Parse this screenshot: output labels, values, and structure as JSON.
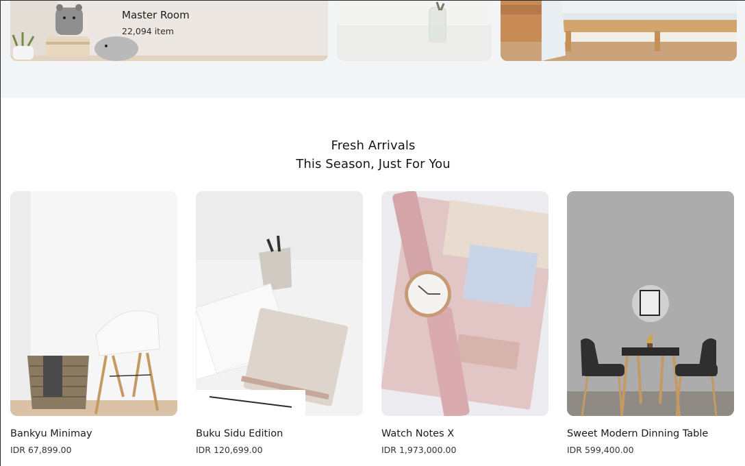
{
  "categories": [
    {
      "title": "Master Room",
      "count": "22,094 item"
    },
    {
      "title": "",
      "count": ""
    },
    {
      "title": "",
      "count": ""
    }
  ],
  "section": {
    "title_line1": "Fresh Arrivals",
    "title_line2": "This Season, Just For You"
  },
  "products": [
    {
      "name": "Bankyu Minimay",
      "price": "IDR 67,899.00"
    },
    {
      "name": "Buku Sidu Edition",
      "price": "IDR 120,699.00"
    },
    {
      "name": "Watch Notes X",
      "price": "IDR 1,973,000.00"
    },
    {
      "name": "Sweet Modern Dinning Table",
      "price": "IDR 599,400.00"
    }
  ]
}
